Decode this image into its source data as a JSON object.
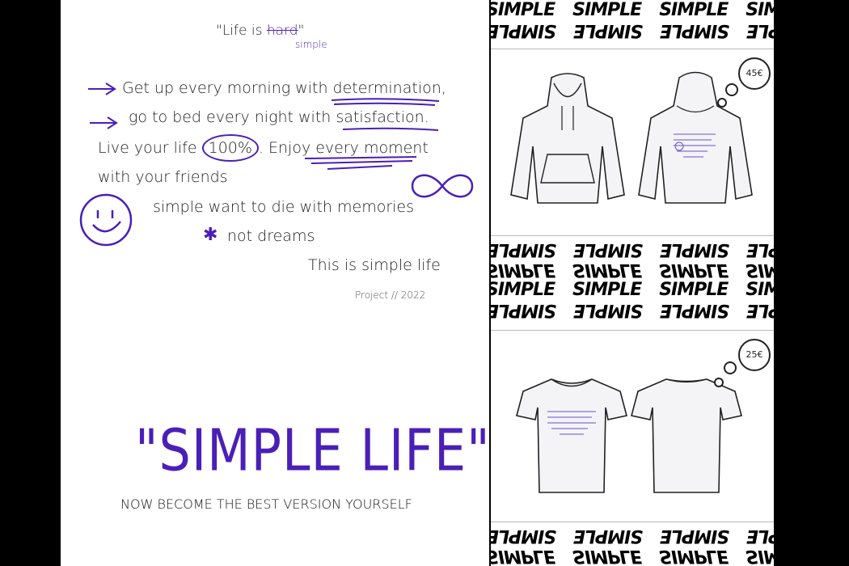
{
  "poem": {
    "quote_open": "\"Life is ",
    "struck": "hard",
    "quote_close": "\"",
    "correction": "simple",
    "line1": "Get up every morning with determination,",
    "line2": "go to bed every night with satisfaction.",
    "line3a": "Live your life",
    "line3b": "100%",
    "line3c": ". Enjoy every moment",
    "line4": "with your friends",
    "line5": "simple want to die with memories",
    "line6": "not dreams",
    "line7": "This is simple life",
    "signature": "Project // 2022"
  },
  "headline": {
    "title": "\"SIMPLE LIFE\"",
    "subtitle": "NOW BECOME THE BEST VERSION YOURSELF"
  },
  "banner": {
    "word": "SIMPLE"
  },
  "products": [
    {
      "name": "hoodie",
      "price": "45€"
    },
    {
      "name": "t-shirt",
      "price": "25€"
    }
  ],
  "colors": {
    "accent": "#4a1fb8",
    "ink": "#222222",
    "background": "#ffffff"
  }
}
